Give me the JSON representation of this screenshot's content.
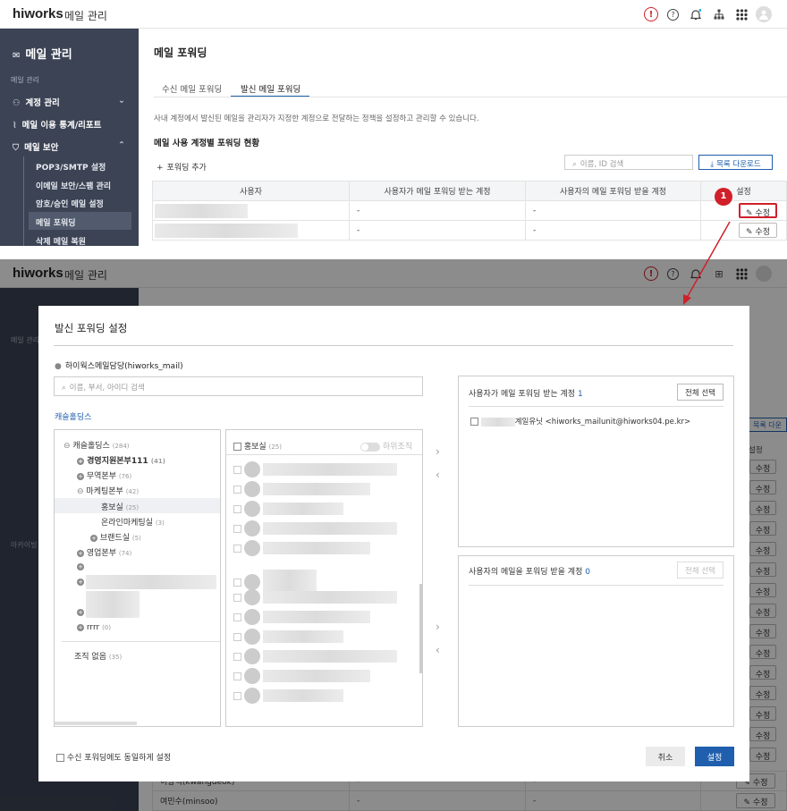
{
  "app": {
    "logo": "hiworks",
    "title": "메일 관리"
  },
  "sidebar": {
    "title": "메일 관리",
    "section": "메일 관리",
    "items": [
      {
        "label": "계정 관리"
      },
      {
        "label": "메일 이용 통계/리포트"
      },
      {
        "label": "메일 보안"
      }
    ],
    "subitems": [
      {
        "label": "POP3/SMTP 설정"
      },
      {
        "label": "이메일 보안/스팸 관리"
      },
      {
        "label": "암호/승인 메일 설정"
      },
      {
        "label": "메일 포워딩"
      },
      {
        "label": "삭제 메일 복원"
      }
    ],
    "archive_section": "아카이빙"
  },
  "page": {
    "title": "메일 포워딩",
    "tabs": [
      {
        "label": "수신 메일 포워딩"
      },
      {
        "label": "발신 메일 포워딩"
      }
    ],
    "description": "사내 계정에서 발신된 메일을 관리자가 지정한 계정으로 전달하는 정책을 설정하고 관리할 수 있습니다.",
    "section_title": "메일 사용 계정별 포워딩 현황",
    "add_label": "포워딩 추가",
    "search_placeholder": "이름, ID 검색",
    "download_label": "목록 다운로드",
    "columns": [
      "사용자",
      "사용자가 메일 포워딩 받는 계정",
      "사용자의 메일 포워딩 받을 계정",
      "설정"
    ],
    "rows": [
      {
        "received": "-",
        "target": "-",
        "action": "수정"
      },
      {
        "received": "-",
        "target": "-",
        "action": "수정"
      }
    ],
    "step_badge": "1"
  },
  "background_rows": [
    {
      "user": "이광덕(kwangdeok)",
      "received": "-",
      "target": "-",
      "action": "수정"
    },
    {
      "user": "여민수(minsoo)",
      "received": "-",
      "target": "-",
      "action": "수정"
    }
  ],
  "bg_side_download": "목록 다운",
  "bg_side_header": "설정",
  "bg_edit_label": "수정",
  "modal": {
    "title": "발신 포워딩 설정",
    "user": "하이웍스메일담당(hiworks_mail)",
    "search_placeholder": "이름, 부서, 아이디 검색",
    "org_name": "캐슬홀딩스",
    "tree": [
      {
        "label": "캐슬홀딩스",
        "count": "(284)"
      },
      {
        "label": "경영지원본부111",
        "count": "(41)"
      },
      {
        "label": "무역본부",
        "count": "(76)"
      },
      {
        "label": "마케팅본부",
        "count": "(42)"
      },
      {
        "label": "홍보실",
        "count": "(25)"
      },
      {
        "label": "온라인마케팅실",
        "count": "(3)"
      },
      {
        "label": "브랜드실",
        "count": "(5)"
      },
      {
        "label": "영업본부",
        "count": "(74)"
      },
      {
        "label": "rrrr",
        "count": "(0)"
      }
    ],
    "no_org": {
      "label": "조직 없음",
      "count": "(35)"
    },
    "member_header": {
      "label": "홍보실",
      "count": "(25)",
      "toggle_label": "하위조직"
    },
    "receive_panel": {
      "title": "사용자가 메일 포워딩 받는 계정",
      "count": "1",
      "select_all": "전체 선택",
      "entry": "계일유닛 <hiworks_mailunit@hiworks04.pe.kr>"
    },
    "target_panel": {
      "title": "사용자의 메일을 포워딩 받을 계정",
      "count": "0",
      "select_all": "전체 선택"
    },
    "same_setting_label": "수신 포워딩에도 동일하게 설정",
    "cancel_label": "취소",
    "save_label": "설정"
  },
  "colors": {
    "accent": "#1f5fae",
    "danger": "#d0202a",
    "sidebar": "#3b4354"
  }
}
